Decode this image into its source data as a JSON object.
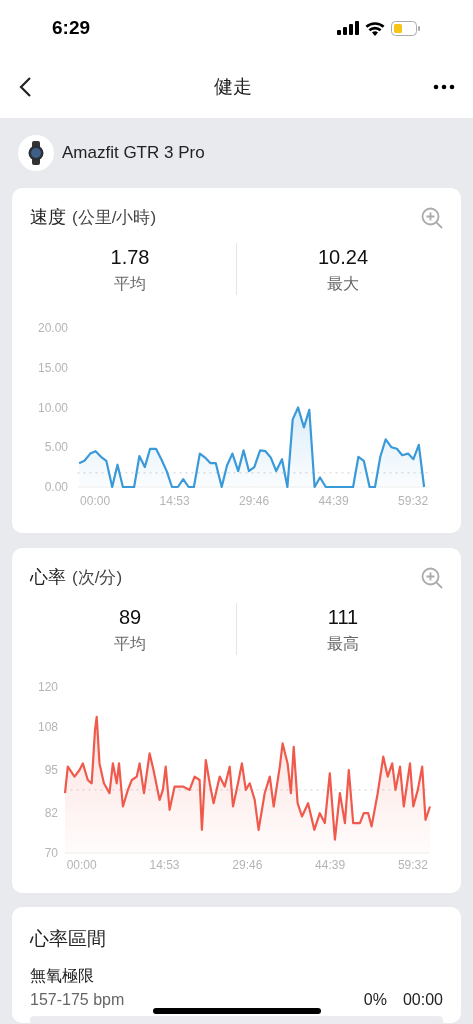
{
  "status_bar": {
    "time": "6:29"
  },
  "nav": {
    "title": "健走"
  },
  "device": {
    "name": "Amazfit GTR 3 Pro"
  },
  "cards": [
    {
      "title": "速度",
      "unit": "(公里/小時)",
      "stats": [
        {
          "value": "1.78",
          "label": "平均"
        },
        {
          "value": "10.24",
          "label": "最大"
        }
      ],
      "chart_data": {
        "type": "area",
        "xlim": [
          -3.2,
          62.7
        ],
        "ylim": [
          0,
          20
        ],
        "xticks": [
          {
            "value": 0,
            "label": "00:00"
          },
          {
            "value": 14.88,
            "label": "14:53"
          },
          {
            "value": 29.77,
            "label": "29:46"
          },
          {
            "value": 44.65,
            "label": "44:39"
          },
          {
            "value": 59.53,
            "label": "59:32"
          }
        ],
        "yticks": [
          {
            "value": 0,
            "label": "0.00"
          },
          {
            "value": 5,
            "label": "5.00"
          },
          {
            "value": 10,
            "label": "10.00"
          },
          {
            "value": 15,
            "label": "15.00"
          },
          {
            "value": 20,
            "label": "20.00"
          }
        ],
        "ref_lines": [
          {
            "axis": "y",
            "value": 1.78
          }
        ],
        "x": [
          -3.0,
          -2.0,
          -0.9,
          0.1,
          1.1,
          2.1,
          3.2,
          4.2,
          5.2,
          6.2,
          7.3,
          8.3,
          9.3,
          10.3,
          11.4,
          12.4,
          13.4,
          14.4,
          15.5,
          16.5,
          17.5,
          18.5,
          19.6,
          20.6,
          21.6,
          22.6,
          23.7,
          24.7,
          25.7,
          26.8,
          27.8,
          28.8,
          29.8,
          30.9,
          31.9,
          32.9,
          33.9,
          35.0,
          36.0,
          37.0,
          38.0,
          39.1,
          40.1,
          41.1,
          42.1,
          43.2,
          44.2,
          45.2,
          46.2,
          47.3,
          48.3,
          49.3,
          50.3,
          51.4,
          52.4,
          53.4,
          54.4,
          55.5,
          56.5,
          57.5,
          58.6,
          59.6,
          60.6,
          61.6
        ],
        "series": [
          {
            "color": "#3a9ad9",
            "values": [
              3,
              3.3,
              4.2,
              4.5,
              3.8,
              3.3,
              0,
              2.8,
              0,
              0,
              0,
              3.9,
              2.5,
              4.8,
              4.8,
              3.5,
              2,
              0,
              0,
              1,
              0,
              0,
              4.2,
              3.7,
              3,
              3,
              0,
              2.7,
              4.2,
              2,
              4.6,
              2,
              2.5,
              4.6,
              4.5,
              3.7,
              2,
              3.5,
              0,
              8.5,
              10,
              7.5,
              9.7,
              0,
              1.2,
              0,
              0,
              0,
              0,
              0,
              0,
              3.8,
              3.3,
              0,
              0,
              3.8,
              6,
              5,
              4.8,
              4,
              4.2,
              3.5,
              5.3,
              0
            ]
          }
        ]
      }
    },
    {
      "title": "心率",
      "unit": "(次/分)",
      "stats": [
        {
          "value": "89",
          "label": "平均"
        },
        {
          "value": "111",
          "label": "最高"
        }
      ],
      "chart_data": {
        "type": "area",
        "xlim": [
          -3,
          62.6
        ],
        "ylim": [
          70,
          120
        ],
        "xticks": [
          {
            "value": 0,
            "label": "00:00"
          },
          {
            "value": 14.88,
            "label": "14:53"
          },
          {
            "value": 29.77,
            "label": "29:46"
          },
          {
            "value": 44.65,
            "label": "44:39"
          },
          {
            "value": 59.53,
            "label": "59:32"
          }
        ],
        "yticks": [
          70,
          82,
          95,
          108,
          120
        ],
        "ref_lines": [
          {
            "axis": "y",
            "value": 89
          }
        ],
        "x": [
          -3.0,
          -2.5,
          -1.3,
          -0.4,
          0.2,
          1.1,
          1.8,
          2.4,
          2.7,
          3.2,
          4.0,
          5.0,
          5.6,
          6.3,
          6.7,
          7.4,
          8.3,
          9.0,
          9.9,
          10.4,
          11.2,
          12.2,
          12.9,
          14.0,
          14.6,
          15.1,
          15.8,
          16.7,
          18.2,
          19.4,
          20.3,
          21.2,
          21.6,
          22.3,
          23.0,
          23.7,
          24.8,
          25.7,
          26.6,
          27.2,
          28.1,
          28.8,
          29.5,
          30.2,
          31.1,
          31.8,
          32.9,
          33.8,
          34.5,
          35.6,
          36.1,
          37.0,
          37.6,
          38.1,
          38.8,
          39.6,
          40.7,
          41.8,
          42.8,
          43.7,
          44.6,
          45.5,
          46.4,
          47.3,
          48.0,
          48.8,
          50.0,
          50.7,
          51.5,
          52.1,
          53.2,
          54.2,
          55.0,
          55.8,
          56.4,
          57.2,
          57.9,
          59.0,
          59.6,
          60.4,
          61.2,
          61.8,
          62.6
        ],
        "series": [
          {
            "color": "#ef5a4c",
            "values": [
              88,
              96,
              93,
              95,
              97,
              92,
              91,
              107,
              111,
              97,
              91,
              88,
              97,
              91,
              97,
              84,
              89,
              92,
              93,
              97,
              88,
              100,
              95,
              86,
              89,
              96,
              83,
              90,
              90,
              89,
              93,
              92,
              77,
              98,
              91,
              85,
              93,
              90,
              96,
              84,
              91,
              97,
              89,
              91,
              86,
              77,
              88,
              93,
              84,
              96,
              103,
              97,
              88,
              102,
              85,
              81,
              85,
              77,
              82,
              79,
              94,
              74,
              88,
              79,
              95,
              79,
              79,
              82,
              82,
              78,
              88,
              99,
              93,
              97,
              89,
              96,
              84,
              97,
              84,
              89,
              96,
              80,
              84
            ]
          }
        ]
      }
    }
  ],
  "zones": {
    "title": "心率區間",
    "items": [
      {
        "name": "無氧極限",
        "range": "157-175 bpm",
        "percent": "0%",
        "time": "00:00"
      }
    ]
  }
}
